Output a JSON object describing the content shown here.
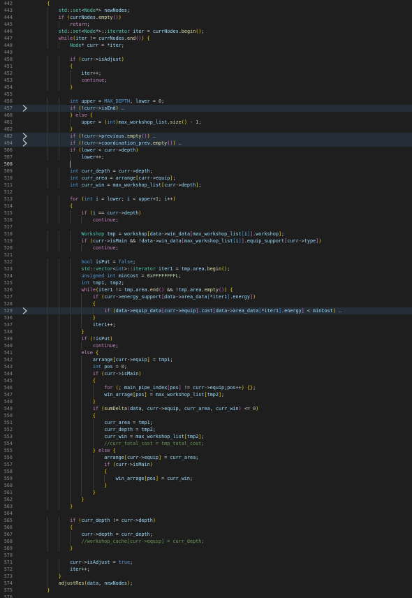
{
  "editor": {
    "language": "cpp",
    "colors": {
      "background": "#1e1e1e",
      "keyword": "#569cd6",
      "control": "#c586c0",
      "type": "#4ec9b0",
      "function": "#dcdcaa",
      "variable": "#9cdcfe",
      "number": "#b5cea8",
      "comment": "#6a9955",
      "line_number": "#858585",
      "bracket_1": "#ffd700",
      "bracket_2": "#da70d6",
      "bracket_3": "#179fff"
    },
    "lines": [
      {
        "n": "442",
        "fold": false,
        "text": "    {"
      },
      {
        "n": "443",
        "fold": false,
        "text": "        std::set<Node*> newNodes;"
      },
      {
        "n": "444",
        "fold": false,
        "text": "        if (currNodes.empty())"
      },
      {
        "n": "445",
        "fold": false,
        "text": "            return;"
      },
      {
        "n": "446",
        "fold": false,
        "text": "        std::set<Node*>::iterator iter = currNodes.begin();"
      },
      {
        "n": "447",
        "fold": false,
        "text": "        while(iter != currNodes.end()) {"
      },
      {
        "n": "448",
        "fold": false,
        "text": "            Node* curr = *iter;"
      },
      {
        "n": "449",
        "fold": false,
        "text": ""
      },
      {
        "n": "450",
        "fold": false,
        "text": "            if (curr->isAdjust)"
      },
      {
        "n": "451",
        "fold": false,
        "text": "            {"
      },
      {
        "n": "452",
        "fold": false,
        "text": "                iter++;"
      },
      {
        "n": "453",
        "fold": false,
        "text": "                continue;"
      },
      {
        "n": "454",
        "fold": false,
        "text": "            }"
      },
      {
        "n": "455",
        "fold": false,
        "text": ""
      },
      {
        "n": "456",
        "fold": false,
        "text": "            int upper = MAX_DEPTH, lower = 0;"
      },
      {
        "n": "457",
        "fold": true,
        "text": "            if (!curr->isEnd) …"
      },
      {
        "n": "460",
        "fold": false,
        "text": "            } else {"
      },
      {
        "n": "461",
        "fold": false,
        "text": "                upper = (int)max_workshop_list.size() - 1;"
      },
      {
        "n": "462",
        "fold": false,
        "text": "            }"
      },
      {
        "n": "482",
        "fold": true,
        "text": "            if (!curr->previous.empty()) …"
      },
      {
        "n": "494",
        "fold": true,
        "text": "            if (!curr->coordination_prev.empty()) …"
      },
      {
        "n": "506",
        "fold": false,
        "text": "            if (lower < curr->depth)"
      },
      {
        "n": "507",
        "fold": false,
        "text": "                lower++;"
      },
      {
        "n": "508",
        "fold": false,
        "text": ""
      },
      {
        "n": "509",
        "fold": false,
        "text": "            int curr_depth = curr->depth;"
      },
      {
        "n": "510",
        "fold": false,
        "text": "            int curr_area = arrange[curr->equip];"
      },
      {
        "n": "511",
        "fold": false,
        "text": "            int curr_win = max_workshop_list[curr->depth];"
      },
      {
        "n": "512",
        "fold": false,
        "text": ""
      },
      {
        "n": "513",
        "fold": false,
        "text": "            for (int i = lower; i < upper+1; i++)"
      },
      {
        "n": "514",
        "fold": false,
        "text": "            {"
      },
      {
        "n": "515",
        "fold": false,
        "text": "                if (i == curr->depth)"
      },
      {
        "n": "516",
        "fold": false,
        "text": "                    continue;"
      },
      {
        "n": "517",
        "fold": false,
        "text": ""
      },
      {
        "n": "518",
        "fold": false,
        "text": "                Workshop tmp = workshop[data->win_data[max_workshop_list[i]].workshop];"
      },
      {
        "n": "519",
        "fold": false,
        "text": "                if (curr->isMain && !data->win_data[max_workshop_list[i]].equip_support[curr->type])"
      },
      {
        "n": "520",
        "fold": false,
        "text": "                    continue;"
      },
      {
        "n": "521",
        "fold": false,
        "text": ""
      },
      {
        "n": "522",
        "fold": false,
        "text": "                bool isPut = false;"
      },
      {
        "n": "523",
        "fold": false,
        "text": "                std::vector<int>::iterator iter1 = tmp.area.begin();"
      },
      {
        "n": "524",
        "fold": false,
        "text": "                unsigned int minCost = 0xFFFFFFFFL;"
      },
      {
        "n": "525",
        "fold": false,
        "text": "                int tmp1, tmp2;"
      },
      {
        "n": "526",
        "fold": false,
        "text": "                while(iter1 != tmp.area.end() && !tmp.area.empty()) {"
      },
      {
        "n": "527",
        "fold": false,
        "text": "                    if (curr->energy_support[data->area_data[*iter1].energy])"
      },
      {
        "n": "528",
        "fold": false,
        "text": "                    {"
      },
      {
        "n": "529",
        "fold": true,
        "text": "                        if (data->equip_data[curr->equip].cost[data->area_data[*iter1].energy] < minCost) …"
      },
      {
        "n": "536",
        "fold": false,
        "text": "                    }"
      },
      {
        "n": "537",
        "fold": false,
        "text": "                    iter1++;"
      },
      {
        "n": "538",
        "fold": false,
        "text": "                }"
      },
      {
        "n": "539",
        "fold": false,
        "text": "                if (!isPut)"
      },
      {
        "n": "540",
        "fold": false,
        "text": "                    continue;"
      },
      {
        "n": "541",
        "fold": false,
        "text": "                else {"
      },
      {
        "n": "542",
        "fold": false,
        "text": "                    arrange[curr->equip] = tmp1;"
      },
      {
        "n": "543",
        "fold": false,
        "text": "                    int pos = 0;"
      },
      {
        "n": "544",
        "fold": false,
        "text": "                    if (curr->isMain)"
      },
      {
        "n": "545",
        "fold": false,
        "text": "                    {"
      },
      {
        "n": "546",
        "fold": false,
        "text": "                        for (; main_pipe_index[pos] != curr->equip;pos++) {};"
      },
      {
        "n": "547",
        "fold": false,
        "text": "                        win_arrage[pos] = max_workshop_list[tmp2];"
      },
      {
        "n": "548",
        "fold": false,
        "text": "                    }"
      },
      {
        "n": "549",
        "fold": false,
        "text": "                    if (sumDelta(data, curr->equip, curr_area, curr_win) <= 0)"
      },
      {
        "n": "550",
        "fold": false,
        "text": "                    {"
      },
      {
        "n": "551",
        "fold": false,
        "text": "                        curr_area = tmp1;"
      },
      {
        "n": "552",
        "fold": false,
        "text": "                        curr_depth = tmp2;"
      },
      {
        "n": "553",
        "fold": false,
        "text": "                        curr_win = max_workshop_list[tmp2];"
      },
      {
        "n": "554",
        "fold": false,
        "text": "                        //curr_total_cost = tmp_total_cost;"
      },
      {
        "n": "555",
        "fold": false,
        "text": "                    } else {"
      },
      {
        "n": "556",
        "fold": false,
        "text": "                        arrange[curr->equip] = curr_area;"
      },
      {
        "n": "557",
        "fold": false,
        "text": "                        if (curr->isMain)"
      },
      {
        "n": "558",
        "fold": false,
        "text": "                        {"
      },
      {
        "n": "559",
        "fold": false,
        "text": "                            win_arrage[pos] = curr_win;"
      },
      {
        "n": "560",
        "fold": false,
        "text": "                        }"
      },
      {
        "n": "561",
        "fold": false,
        "text": "                    }"
      },
      {
        "n": "562",
        "fold": false,
        "text": "                }"
      },
      {
        "n": "563",
        "fold": false,
        "text": "            }"
      },
      {
        "n": "564",
        "fold": false,
        "text": ""
      },
      {
        "n": "565",
        "fold": false,
        "text": "            if (curr_depth != curr->depth)"
      },
      {
        "n": "566",
        "fold": false,
        "text": "            {"
      },
      {
        "n": "567",
        "fold": false,
        "text": "                curr->depth = curr_depth;"
      },
      {
        "n": "568",
        "fold": false,
        "text": "                //workshop_cache[curr->equip] = curr_depth;"
      },
      {
        "n": "569",
        "fold": false,
        "text": "            }"
      },
      {
        "n": "570",
        "fold": false,
        "text": ""
      },
      {
        "n": "571",
        "fold": false,
        "text": "            curr->isAdjust = true;"
      },
      {
        "n": "572",
        "fold": false,
        "text": "            iter++;"
      },
      {
        "n": "573",
        "fold": false,
        "text": "        }"
      },
      {
        "n": "574",
        "fold": false,
        "text": "        adjustRes(data, newNodes);"
      },
      {
        "n": "575",
        "fold": false,
        "text": "    }"
      },
      {
        "n": "576",
        "fold": false,
        "text": ""
      }
    ]
  }
}
